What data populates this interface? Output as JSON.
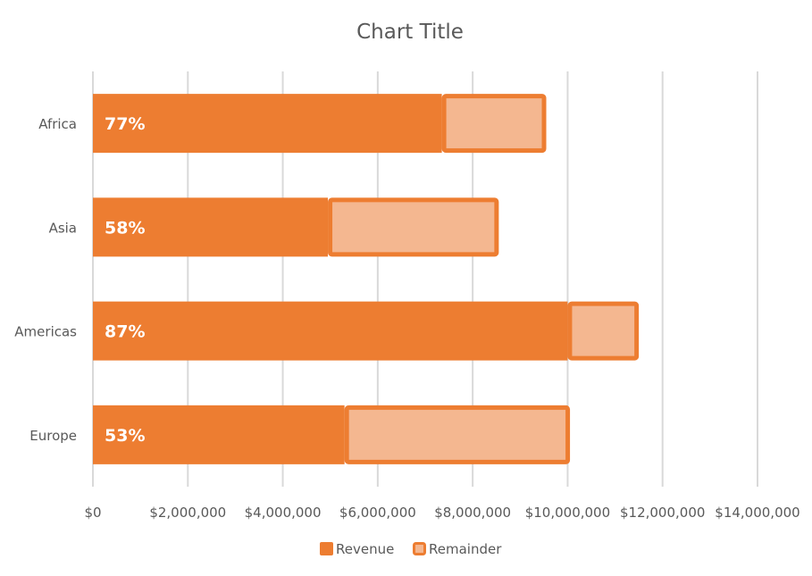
{
  "chart_data": {
    "type": "bar",
    "orientation": "horizontal",
    "stacked": true,
    "title": "Chart Title",
    "xlabel": "",
    "ylabel": "",
    "categories": [
      "Africa",
      "Asia",
      "Americas",
      "Europe"
    ],
    "series": [
      {
        "name": "Revenue",
        "values": [
          7350000,
          4950000,
          10000000,
          5300000
        ],
        "color": "#ED7D31"
      },
      {
        "name": "Remainder",
        "values": [
          2200000,
          3600000,
          1500000,
          4750000
        ],
        "color": "#F4B790",
        "border_color": "#ED7D31"
      }
    ],
    "data_labels": [
      "77%",
      "58%",
      "87%",
      "53%"
    ],
    "xlim": [
      0,
      14000000
    ],
    "xticks": [
      0,
      2000000,
      4000000,
      6000000,
      8000000,
      10000000,
      12000000,
      14000000
    ],
    "xtick_labels": [
      "$0",
      "$2,000,000",
      "$4,000,000",
      "$6,000,000",
      "$8,000,000",
      "$10,000,000",
      "$12,000,000",
      "$14,000,000"
    ],
    "grid": true,
    "legend": {
      "position": "bottom",
      "entries": [
        "Revenue",
        "Remainder"
      ]
    }
  }
}
